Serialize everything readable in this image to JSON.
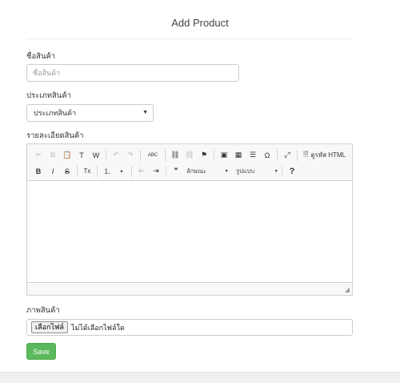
{
  "page": {
    "title": "Add Product"
  },
  "form": {
    "name": {
      "label": "ชื่อสินค้า",
      "placeholder": "ชื่อสินค้า",
      "value": ""
    },
    "category": {
      "label": "ประเภทสินค้า",
      "selected": "ประเภทสินค้า"
    },
    "description": {
      "label": "รายละเอียดสินค้า",
      "toolbar": {
        "row1": [
          {
            "icon": "cut-icon",
            "glyph": "✂",
            "enabled": false
          },
          {
            "icon": "copy-icon",
            "glyph": "⧉",
            "enabled": false
          },
          {
            "icon": "paste-icon",
            "glyph": "📋",
            "enabled": true
          },
          {
            "icon": "paste-text-icon",
            "glyph": "T",
            "enabled": true
          },
          {
            "icon": "paste-word-icon",
            "glyph": "W",
            "enabled": true
          },
          {
            "icon": "undo-icon",
            "glyph": "↶",
            "enabled": false
          },
          {
            "icon": "redo-icon",
            "glyph": "↷",
            "enabled": false
          },
          {
            "icon": "spellcheck-icon",
            "glyph": "ABC",
            "enabled": true
          },
          {
            "icon": "link-icon",
            "glyph": "⛓",
            "enabled": true
          },
          {
            "icon": "unlink-icon",
            "glyph": "⛓",
            "enabled": false
          },
          {
            "icon": "anchor-icon",
            "glyph": "⚑",
            "enabled": true
          },
          {
            "icon": "image-icon",
            "glyph": "▣",
            "enabled": true
          },
          {
            "icon": "table-icon",
            "glyph": "▦",
            "enabled": true
          },
          {
            "icon": "horizontal-rule-icon",
            "glyph": "☰",
            "enabled": true
          },
          {
            "icon": "special-char-icon",
            "glyph": "Ω",
            "enabled": true
          },
          {
            "icon": "maximize-icon",
            "glyph": "⤢",
            "enabled": true
          }
        ],
        "source_label": "ดูรหัส HTML",
        "row2": [
          {
            "icon": "bold-icon",
            "glyph": "B",
            "enabled": true
          },
          {
            "icon": "italic-icon",
            "glyph": "I",
            "enabled": true
          },
          {
            "icon": "strike-icon",
            "glyph": "S",
            "enabled": true
          },
          {
            "icon": "remove-format-icon",
            "glyph": "Tx",
            "enabled": true
          },
          {
            "icon": "numbered-list-icon",
            "glyph": "⒈",
            "enabled": true
          },
          {
            "icon": "bulleted-list-icon",
            "glyph": "•",
            "enabled": true
          },
          {
            "icon": "outdent-icon",
            "glyph": "⇤",
            "enabled": false
          },
          {
            "icon": "indent-icon",
            "glyph": "⇥",
            "enabled": true
          },
          {
            "icon": "blockquote-icon",
            "glyph": "❞",
            "enabled": true
          }
        ],
        "style_combo": "ลักษณะ",
        "format_combo": "รูปแบบ",
        "help_glyph": "?"
      }
    },
    "image": {
      "label": "ภาพสินค้า",
      "button": "เลือกไฟล์",
      "status": "ไม่ได้เลือกไฟล์ใด"
    },
    "save_label": "Save"
  }
}
